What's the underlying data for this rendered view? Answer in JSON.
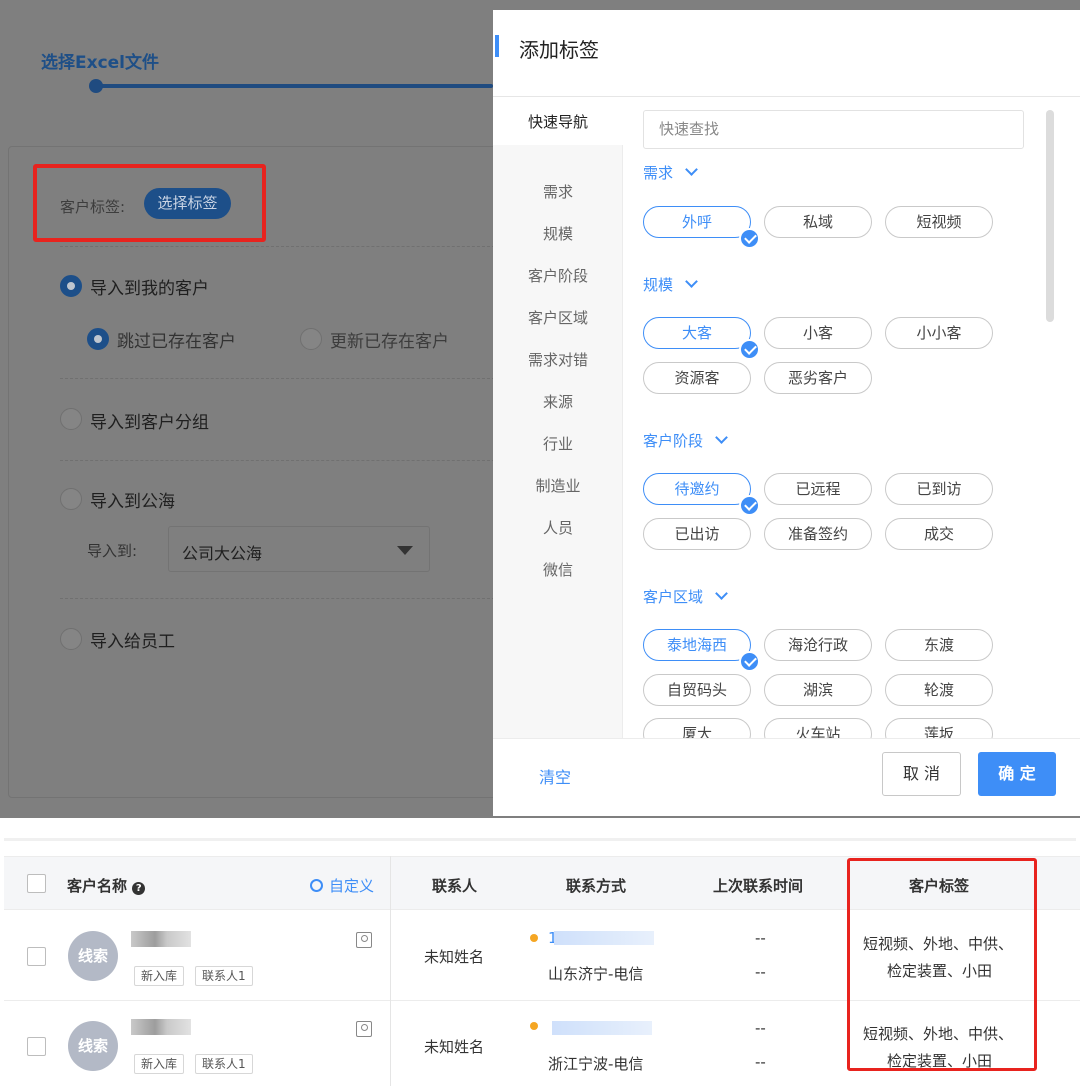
{
  "bg": {
    "step_label": "选择Excel文件",
    "customer_tag_label": "客户标签:",
    "select_tag_button": "选择标签",
    "options": {
      "import_mine": "导入到我的客户",
      "skip_existing": "跳过已存在客户",
      "update_existing": "更新已存在客户",
      "import_group": "导入到客户分组",
      "import_sea": "导入到公海",
      "import_to_label": "导入到:",
      "import_to_value": "公司大公海",
      "import_employee": "导入给员工"
    }
  },
  "modal": {
    "title": "添加标签",
    "nav_header": "快速导航",
    "nav_items": [
      "需求",
      "规模",
      "客户阶段",
      "客户区域",
      "需求对错",
      "来源",
      "行业",
      "制造业",
      "人员",
      "微信"
    ],
    "search_placeholder": "快速查找",
    "sections": [
      {
        "title": "需求",
        "chips": [
          {
            "label": "外呼",
            "selected": true
          },
          {
            "label": "私域",
            "selected": false
          },
          {
            "label": "短视频",
            "selected": false
          }
        ]
      },
      {
        "title": "规模",
        "chips": [
          {
            "label": "大客",
            "selected": true
          },
          {
            "label": "小客",
            "selected": false
          },
          {
            "label": "小小客",
            "selected": false
          },
          {
            "label": "资源客",
            "selected": false
          },
          {
            "label": "恶劣客户",
            "selected": false
          }
        ]
      },
      {
        "title": "客户阶段",
        "chips": [
          {
            "label": "待邀约",
            "selected": true
          },
          {
            "label": "已远程",
            "selected": false
          },
          {
            "label": "已到访",
            "selected": false
          },
          {
            "label": "已出访",
            "selected": false
          },
          {
            "label": "准备签约",
            "selected": false
          },
          {
            "label": "成交",
            "selected": false
          }
        ]
      },
      {
        "title": "客户区域",
        "chips": [
          {
            "label": "泰地海西",
            "selected": true
          },
          {
            "label": "海沧行政",
            "selected": false
          },
          {
            "label": "东渡",
            "selected": false
          },
          {
            "label": "自贸码头",
            "selected": false
          },
          {
            "label": "湖滨",
            "selected": false
          },
          {
            "label": "轮渡",
            "selected": false
          },
          {
            "label": "厦大",
            "selected": false
          },
          {
            "label": "火车站",
            "selected": false
          },
          {
            "label": "莲坂",
            "selected": false
          }
        ]
      }
    ],
    "clear_label": "清空",
    "cancel_label": "取 消",
    "ok_label": "确 定",
    "accent": "#3e8ef7"
  },
  "table": {
    "headers": {
      "name": "客户名称",
      "customize": "自定义",
      "contact": "联系人",
      "method": "联系方式",
      "last_time": "上次联系时间",
      "tags": "客户标签"
    },
    "rows": [
      {
        "avatar": "线索",
        "badges": [
          "新入库",
          "联系人1"
        ],
        "contact": "未知姓名",
        "phone_prefix": "1",
        "location": "山东济宁-电信",
        "last_time_a": "--",
        "last_time_b": "--",
        "tags_line1": "短视频、外地、中供、",
        "tags_line2": "检定装置、小田"
      },
      {
        "avatar": "线索",
        "badges": [
          "新入库",
          "联系人1"
        ],
        "contact": "未知姓名",
        "phone_prefix": "",
        "location": "浙江宁波-电信",
        "last_time_a": "--",
        "last_time_b": "--",
        "tags_line1": "短视频、外地、中供、",
        "tags_line2": "检定装置、小田"
      }
    ]
  }
}
